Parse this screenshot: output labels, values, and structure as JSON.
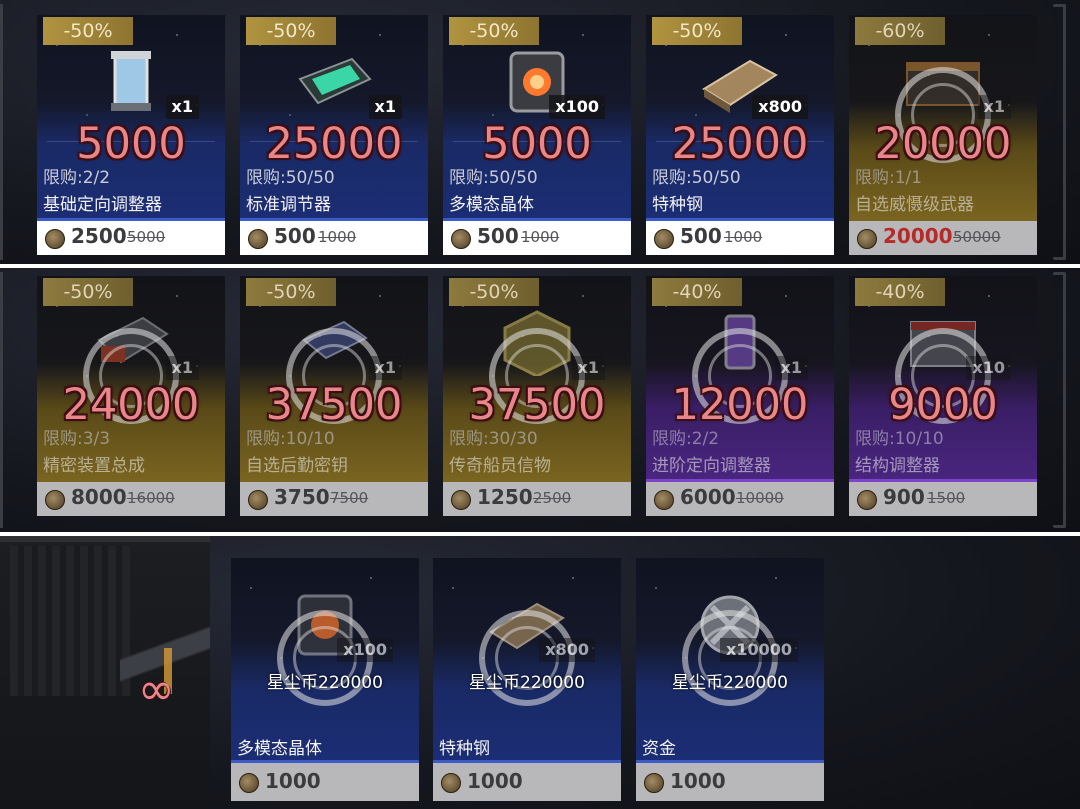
{
  "row1": [
    {
      "discount": "-50%",
      "qty": "x1",
      "overlay": "5000",
      "limit": "限购:2/2",
      "name": "基础定向调整器",
      "price": "2500",
      "old_price": "5000",
      "theme": "blue",
      "icon": "container-icon"
    },
    {
      "discount": "-50%",
      "qty": "x1",
      "overlay": "25000",
      "limit": "限购:50/50",
      "name": "标准调节器",
      "price": "500",
      "old_price": "1000",
      "theme": "blue",
      "icon": "capsule-icon"
    },
    {
      "discount": "-50%",
      "qty": "x100",
      "overlay": "5000",
      "limit": "限购:50/50",
      "name": "多模态晶体",
      "price": "500",
      "old_price": "1000",
      "theme": "blue",
      "icon": "crystal-cube-icon"
    },
    {
      "discount": "-50%",
      "qty": "x800",
      "overlay": "25000",
      "limit": "限购:50/50",
      "name": "特种钢",
      "price": "500",
      "old_price": "1000",
      "theme": "blue",
      "icon": "steel-ingot-icon"
    },
    {
      "discount": "-60%",
      "qty": "x1",
      "overlay": "20000",
      "limit": "限购:1/1",
      "name": "自选威慑级武器",
      "price": "20000",
      "old_price": "50000",
      "theme": "gold",
      "icon": "weapon-crate-icon"
    }
  ],
  "row2": [
    {
      "discount": "-50%",
      "qty": "x1",
      "overlay": "24000",
      "limit": "限购:3/3",
      "name": "精密装置总成",
      "price": "8000",
      "old_price": "16000",
      "theme": "gold",
      "icon": "device-assembly-icon"
    },
    {
      "discount": "-50%",
      "qty": "x1",
      "overlay": "37500",
      "limit": "限购:10/10",
      "name": "自选后勤密钥",
      "price": "3750",
      "old_price": "7500",
      "theme": "gold",
      "icon": "key-chip-icon"
    },
    {
      "discount": "-50%",
      "qty": "x1",
      "overlay": "37500",
      "limit": "限购:30/30",
      "name": "传奇船员信物",
      "price": "1250",
      "old_price": "2500",
      "theme": "gold",
      "icon": "token-hex-icon"
    },
    {
      "discount": "-40%",
      "qty": "x1",
      "overlay": "12000",
      "limit": "限购:2/2",
      "name": "进阶定向调整器",
      "price": "6000",
      "old_price": "10000",
      "theme": "purple",
      "icon": "purple-container-icon"
    },
    {
      "discount": "-40%",
      "qty": "x10",
      "overlay": "9000",
      "limit": "限购:10/10",
      "name": "结构调整器",
      "price": "900",
      "old_price": "1500",
      "theme": "purple",
      "icon": "structure-box-icon"
    }
  ],
  "row3": [
    {
      "qty": "x100",
      "overlay": "星尘币220000",
      "name": "多模态晶体",
      "price": "1000",
      "icon": "crystal-cube-icon"
    },
    {
      "qty": "x800",
      "overlay": "星尘币220000",
      "name": "特种钢",
      "price": "1000",
      "icon": "steel-ingot-icon"
    },
    {
      "qty": "x10000",
      "overlay": "星尘币220000",
      "name": "资金",
      "price": "1000",
      "icon": "fund-coin-icon"
    }
  ],
  "infinity_symbol": "∞",
  "colors": {
    "overlay_number": "#e9868a",
    "discount_badge": "#b09440",
    "blue_tier": "#1b2d75",
    "gold_tier": "#7b6520",
    "purple_tier": "#4a2680",
    "sale_red": "#b62a28"
  }
}
